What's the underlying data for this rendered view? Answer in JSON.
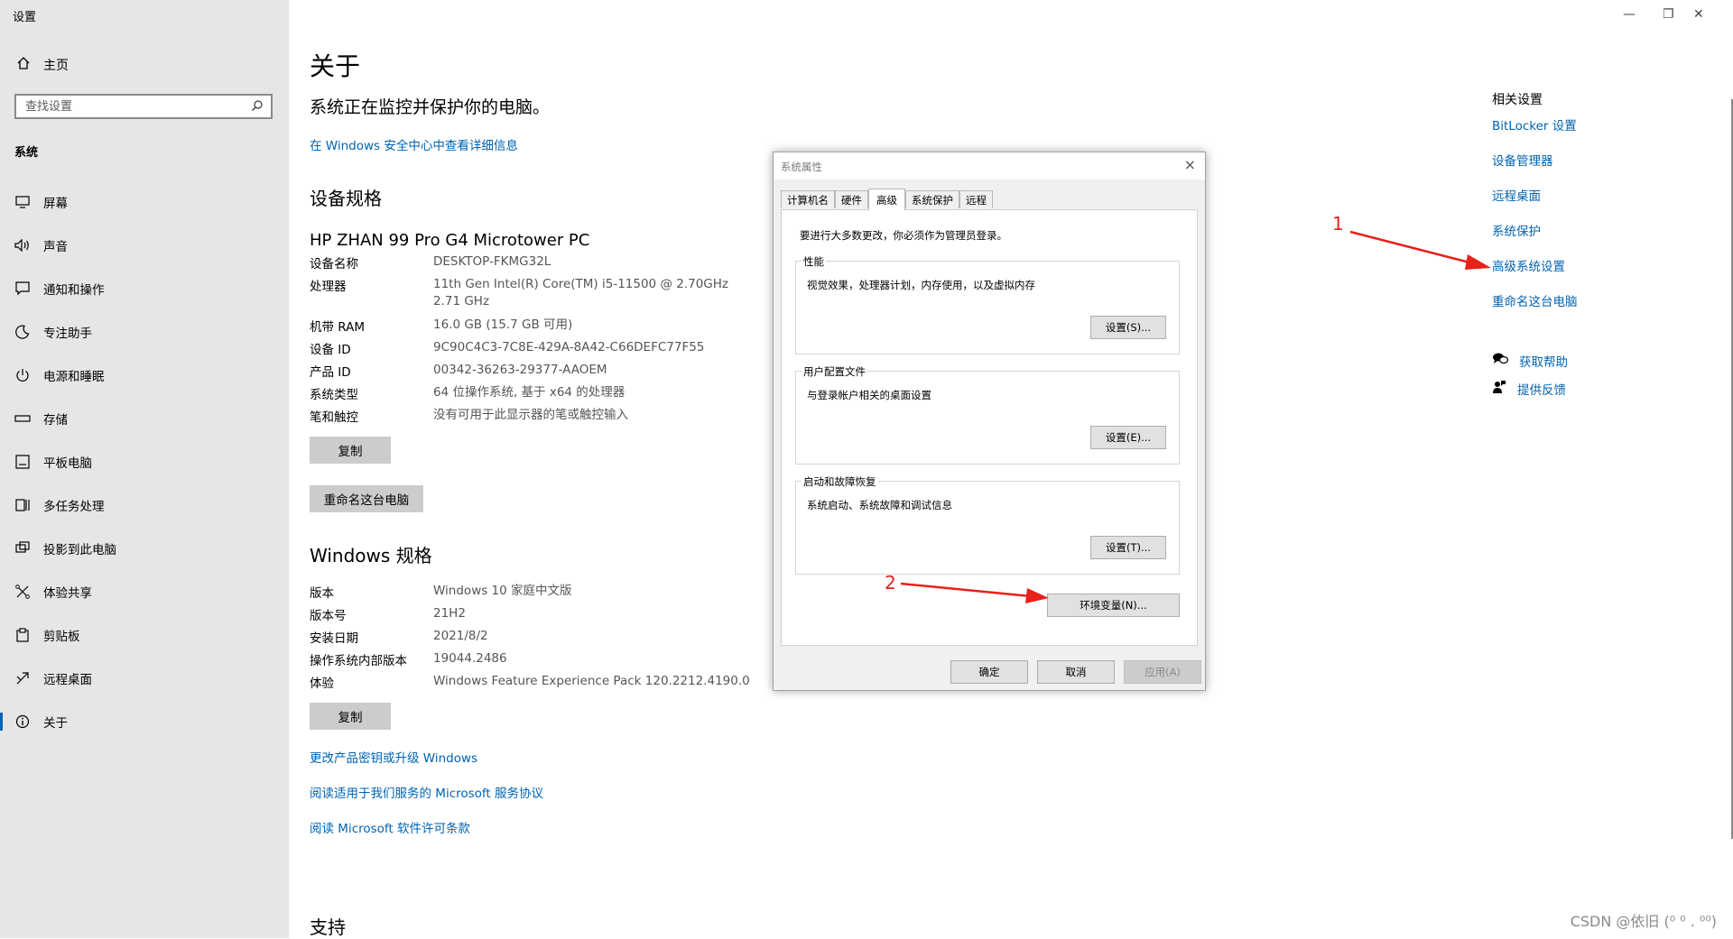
{
  "window": {
    "title": "设置",
    "minimize": "—",
    "restore": "❐",
    "close": "✕"
  },
  "sidebar": {
    "home_label": "主页",
    "search_placeholder": "查找设置",
    "section": "系统",
    "items": [
      {
        "label": "屏幕",
        "icon": "monitor-icon"
      },
      {
        "label": "声音",
        "icon": "speaker-icon"
      },
      {
        "label": "通知和操作",
        "icon": "notification-icon"
      },
      {
        "label": "专注助手",
        "icon": "moon-icon"
      },
      {
        "label": "电源和睡眠",
        "icon": "power-icon"
      },
      {
        "label": "存储",
        "icon": "storage-icon"
      },
      {
        "label": "平板电脑",
        "icon": "tablet-icon"
      },
      {
        "label": "多任务处理",
        "icon": "multitask-icon"
      },
      {
        "label": "投影到此电脑",
        "icon": "project-icon"
      },
      {
        "label": "体验共享",
        "icon": "share-icon"
      },
      {
        "label": "剪贴板",
        "icon": "clipboard-icon"
      },
      {
        "label": "远程桌面",
        "icon": "remote-desktop-icon"
      },
      {
        "label": "关于",
        "icon": "info-icon"
      }
    ]
  },
  "main": {
    "title": "关于",
    "subtitle": "系统正在监控并保护你的电脑。",
    "security_link": "在 Windows 安全中心中查看详细信息",
    "device_specs": {
      "heading": "设备规格",
      "device_name": "HP ZHAN 99 Pro G4 Microtower PC",
      "rows": [
        {
          "key": "设备名称",
          "value": "DESKTOP-FKMG32L"
        },
        {
          "key": "处理器",
          "value": "11th Gen Intel(R) Core(TM) i5-11500 @ 2.70GHz",
          "value2": "2.71 GHz"
        },
        {
          "key": "机带 RAM",
          "value": "16.0 GB (15.7 GB 可用)"
        },
        {
          "key": "设备 ID",
          "value": "9C90C4C3-7C8E-429A-8A42-C66DEFC77F55"
        },
        {
          "key": "产品 ID",
          "value": "00342-36263-29377-AAOEM"
        },
        {
          "key": "系统类型",
          "value": "64 位操作系统, 基于 x64 的处理器"
        },
        {
          "key": "笔和触控",
          "value": "没有可用于此显示器的笔或触控输入"
        }
      ],
      "copy_button": "复制",
      "rename_button": "重命名这台电脑"
    },
    "windows_specs": {
      "heading": "Windows 规格",
      "rows": [
        {
          "key": "版本",
          "value": "Windows 10 家庭中文版"
        },
        {
          "key": "版本号",
          "value": "21H2"
        },
        {
          "key": "安装日期",
          "value": "2021/8/2"
        },
        {
          "key": "操作系统内部版本",
          "value": "19044.2486"
        },
        {
          "key": "体验",
          "value": "Windows Feature Experience Pack 120.2212.4190.0"
        }
      ],
      "copy_button": "复制"
    },
    "links": [
      "更改产品密钥或升级 Windows",
      "阅读适用于我们服务的 Microsoft 服务协议",
      "阅读 Microsoft 软件许可条款"
    ],
    "support_heading": "支持"
  },
  "related": {
    "heading": "相关设置",
    "links": [
      "BitLocker 设置",
      "设备管理器",
      "远程桌面",
      "系统保护",
      "高级系统设置",
      "重命名这台电脑"
    ],
    "help": "获取帮助",
    "feedback": "提供反馈"
  },
  "dialog": {
    "title": "系统属性",
    "close": "×",
    "tabs": [
      "计算机名",
      "硬件",
      "高级",
      "系统保护",
      "远程"
    ],
    "active_tab": "高级",
    "admin_note": "要进行大多数更改，你必须作为管理员登录。",
    "groups": [
      {
        "title": "性能",
        "desc": "视觉效果，处理器计划，内存使用，以及虚拟内存",
        "button": "设置(S)..."
      },
      {
        "title": "用户配置文件",
        "desc": "与登录帐户相关的桌面设置",
        "button": "设置(E)..."
      },
      {
        "title": "启动和故障恢复",
        "desc": "系统启动、系统故障和调试信息",
        "button": "设置(T)..."
      }
    ],
    "env_button": "环境变量(N)...",
    "ok": "确定",
    "cancel": "取消",
    "apply": "应用(A)"
  },
  "annotations": {
    "label1": "1",
    "label2": "2",
    "color": "#e8211a"
  },
  "watermark": "CSDN @依旧 (⁰ ⁰ . ⁰⁰)",
  "colors": {
    "accent": "#0063b1",
    "sidebar_bg": "#e6e6e6",
    "button_gray": "#cccccc"
  }
}
